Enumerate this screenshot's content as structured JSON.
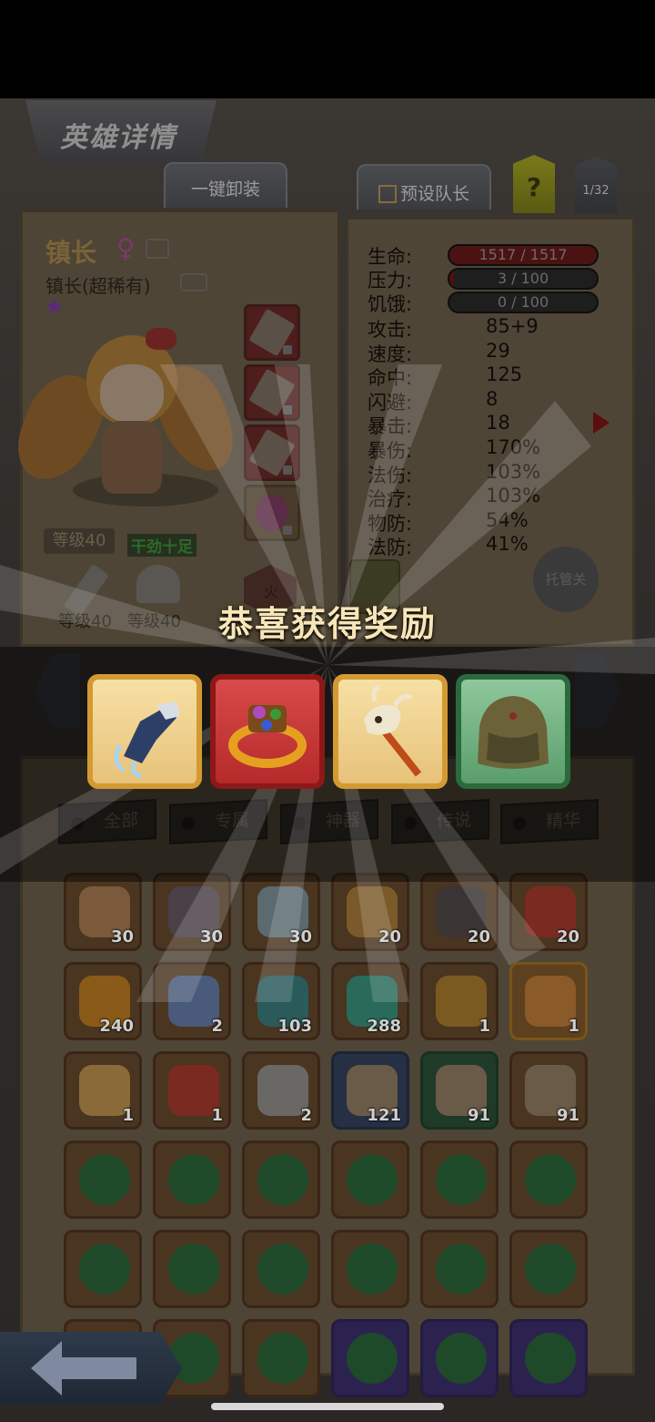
{
  "header": {
    "title": "英雄详情",
    "unequip_all": "一键卸装",
    "preset_leader": "预设队长",
    "help": "?",
    "page_count": "1/32"
  },
  "hero": {
    "name": "镇长",
    "gender_symbol": "♀",
    "subtitle": "镇长(超稀有)",
    "star": "★",
    "level": "等级40",
    "mood": "干劲十足",
    "weapon_level": "等级40",
    "armor_level": "等级40",
    "fire_slot": "火"
  },
  "stats": {
    "bars": [
      {
        "label": "生命:",
        "value": "1517 / 1517",
        "fraction": 1.0
      },
      {
        "label": "压力:",
        "value": "3 / 100",
        "fraction": 0.03
      },
      {
        "label": "饥饿:",
        "value": "0 / 100",
        "fraction": 0.0
      }
    ],
    "values": [
      {
        "label": "攻击:",
        "value": "85+9"
      },
      {
        "label": "速度:",
        "value": "29"
      },
      {
        "label": "命中:",
        "value": "125"
      },
      {
        "label": "闪避:",
        "value": "8"
      },
      {
        "label": "暴击:",
        "value": "18"
      },
      {
        "label": "暴伤:",
        "value": "170%"
      },
      {
        "label": "法伤:",
        "value": "103%"
      },
      {
        "label": "治疗:",
        "value": "103%"
      },
      {
        "label": "物防:",
        "value": "54%"
      },
      {
        "label": "法防:",
        "value": "41%"
      }
    ],
    "auto_button": "托管关"
  },
  "reward_popup": {
    "title": "恭喜获得奖励",
    "items": [
      {
        "name": "gauntlet-icon",
        "rarity": "gold"
      },
      {
        "name": "ring-icon",
        "rarity": "red"
      },
      {
        "name": "bone-staff-icon",
        "rarity": "gold"
      },
      {
        "name": "backpack-icon",
        "rarity": "green"
      }
    ]
  },
  "filters": [
    "全部",
    "专属",
    "神器",
    "传说",
    "精华"
  ],
  "inventory": [
    {
      "icon": "hero-portrait-1",
      "count": "30",
      "tone": "brown",
      "art": "#7a5a3a"
    },
    {
      "icon": "hero-portrait-2",
      "count": "30",
      "tone": "brown",
      "art": "#4a4048"
    },
    {
      "icon": "hero-portrait-3",
      "count": "30",
      "tone": "brown",
      "art": "#5a6a6e"
    },
    {
      "icon": "hero-portrait-4",
      "count": "20",
      "tone": "brown",
      "art": "#7a5a2a"
    },
    {
      "icon": "hero-portrait-5",
      "count": "20",
      "tone": "brown",
      "art": "#3a3434"
    },
    {
      "icon": "hero-portrait-6",
      "count": "20",
      "tone": "brown",
      "art": "#7a2a20"
    },
    {
      "icon": "rune-stone-icon",
      "count": "240",
      "tone": "brown",
      "art": "#8a5a18"
    },
    {
      "icon": "crystal-pile-icon",
      "count": "2",
      "tone": "brown",
      "art": "#4a5a7a"
    },
    {
      "icon": "teal-gem-icon",
      "count": "103",
      "tone": "brown",
      "art": "#2a5a5a"
    },
    {
      "icon": "potion-icon",
      "count": "288",
      "tone": "brown",
      "art": "#2a6a5a"
    },
    {
      "icon": "golden-orb-icon",
      "count": "1",
      "tone": "brown",
      "art": "#7a5a20"
    },
    {
      "icon": "chest-icon",
      "count": "1",
      "tone": "gold",
      "art": "#8a5a28"
    },
    {
      "icon": "chest-icon",
      "count": "1",
      "tone": "brown",
      "art": "#8a6a38"
    },
    {
      "icon": "demon-mask-icon",
      "count": "1",
      "tone": "brown",
      "art": "#7a2a20"
    },
    {
      "icon": "feather-icon",
      "count": "2",
      "tone": "brown",
      "art": "#6a6864"
    },
    {
      "icon": "chest-icon",
      "count": "121",
      "tone": "blue",
      "art": "#6a5a48"
    },
    {
      "icon": "chest-icon",
      "count": "91",
      "tone": "green",
      "art": "#6a5a48"
    },
    {
      "icon": "chest-icon",
      "count": "91",
      "tone": "brown",
      "art": "#6a5a48"
    },
    {
      "icon": "green-orb-icon",
      "count": "",
      "tone": "brown",
      "art": "#1e4a2a"
    },
    {
      "icon": "green-orb-icon",
      "count": "",
      "tone": "brown",
      "art": "#1e4a2a"
    },
    {
      "icon": "green-orb-icon",
      "count": "",
      "tone": "brown",
      "art": "#1e4a2a"
    },
    {
      "icon": "green-orb-icon",
      "count": "",
      "tone": "brown",
      "art": "#1e4a2a"
    },
    {
      "icon": "green-orb-icon",
      "count": "",
      "tone": "brown",
      "art": "#1e4a2a"
    },
    {
      "icon": "green-orb-icon",
      "count": "",
      "tone": "brown",
      "art": "#1e4a2a"
    },
    {
      "icon": "green-orb-icon",
      "count": "",
      "tone": "brown",
      "art": "#1e4a2a"
    },
    {
      "icon": "green-orb-icon",
      "count": "",
      "tone": "brown",
      "art": "#1e4a2a"
    },
    {
      "icon": "green-orb-icon",
      "count": "",
      "tone": "brown",
      "art": "#1e4a2a"
    },
    {
      "icon": "green-orb-icon",
      "count": "",
      "tone": "brown",
      "art": "#1e4a2a"
    },
    {
      "icon": "green-orb-icon",
      "count": "",
      "tone": "brown",
      "art": "#1e4a2a"
    },
    {
      "icon": "green-orb-icon",
      "count": "",
      "tone": "brown",
      "art": "#1e4a2a"
    },
    {
      "icon": "green-orb-icon",
      "count": "",
      "tone": "brown",
      "art": "#1e4a2a"
    },
    {
      "icon": "green-orb-icon",
      "count": "",
      "tone": "brown",
      "art": "#1e4a2a"
    },
    {
      "icon": "green-orb-icon",
      "count": "",
      "tone": "brown",
      "art": "#1e4a2a"
    },
    {
      "icon": "green-orb-icon",
      "count": "",
      "tone": "purple",
      "art": "#1e4a2a"
    },
    {
      "icon": "green-orb-icon",
      "count": "",
      "tone": "purple",
      "art": "#1e4a2a"
    },
    {
      "icon": "green-orb-icon",
      "count": "",
      "tone": "purple",
      "art": "#1e4a2a"
    }
  ],
  "colors": {
    "reward_title": "#f6e6b8",
    "rarity_gold": "#d49a32",
    "rarity_red": "#8e1818",
    "rarity_green": "#2b6a3c"
  }
}
